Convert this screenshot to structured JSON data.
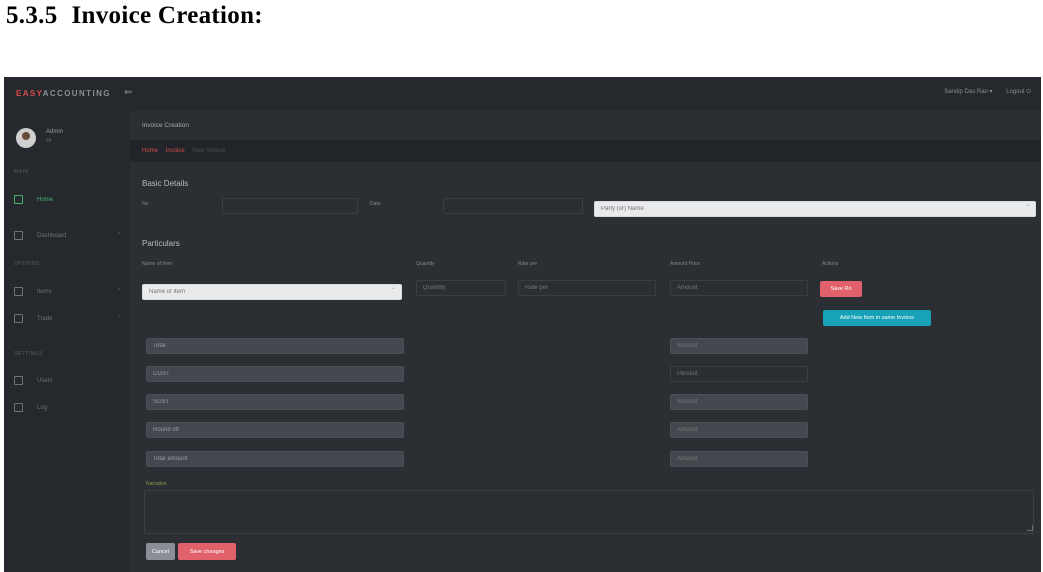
{
  "doc": {
    "section_number": "5.3.5",
    "section_title": "Invoice Creation:"
  },
  "topbar": {
    "brand_a": "EASY",
    "brand_b": "ACCOUNTING",
    "toggle": "⇐",
    "user_menu": "Sandip Das Rao ▾",
    "logout": "Logout ⏻"
  },
  "sidebar": {
    "user": {
      "name": "Admin",
      "role": "##"
    },
    "items": [
      {
        "label": "Home",
        "icon": "home-icon"
      },
      {
        "label": "Dashboard",
        "icon": "dashboard-icon"
      },
      {
        "label": "Items",
        "icon": "box-icon"
      },
      {
        "label": "Trade",
        "icon": "trade-icon"
      },
      {
        "label": "Users",
        "icon": "users-icon"
      },
      {
        "label": "Log",
        "icon": "log-icon"
      }
    ],
    "sections": [
      "MAIN",
      "OPTIONS",
      "SETTINGS"
    ]
  },
  "main": {
    "page_title": "Invoice Creation",
    "breadcrumbs": [
      "Home",
      "Invoice",
      "New Invoice"
    ],
    "basic": {
      "title": "Basic Details",
      "no_label": "No",
      "date_label": "Date",
      "party_placeholder": "Party (or) Name"
    },
    "particulars": {
      "title": "Particulars",
      "col_item": "Name of Item",
      "col_qty": "Quantity",
      "col_rate": "Rate per",
      "col_amount": "Amount Price",
      "col_actions": "Actions",
      "item_placeholder": "Name of Item",
      "qty_placeholder": "Quantity",
      "rate_placeholder": "Rate per",
      "amount_placeholder": "Amount",
      "save_row": "Save Ro",
      "add_item": "Add New Item in same Invoice"
    },
    "totals": [
      {
        "label": "Total",
        "amount": "Amount"
      },
      {
        "label": "CGST",
        "amount": "Percent"
      },
      {
        "label": "SGST",
        "amount": "Amount"
      },
      {
        "label": "Round off",
        "amount": "Amount"
      },
      {
        "label": "Total amount",
        "amount": "Amount"
      }
    ],
    "narration_label": "Narration",
    "cancel": "Cancel",
    "save_changes": "Save changes"
  }
}
